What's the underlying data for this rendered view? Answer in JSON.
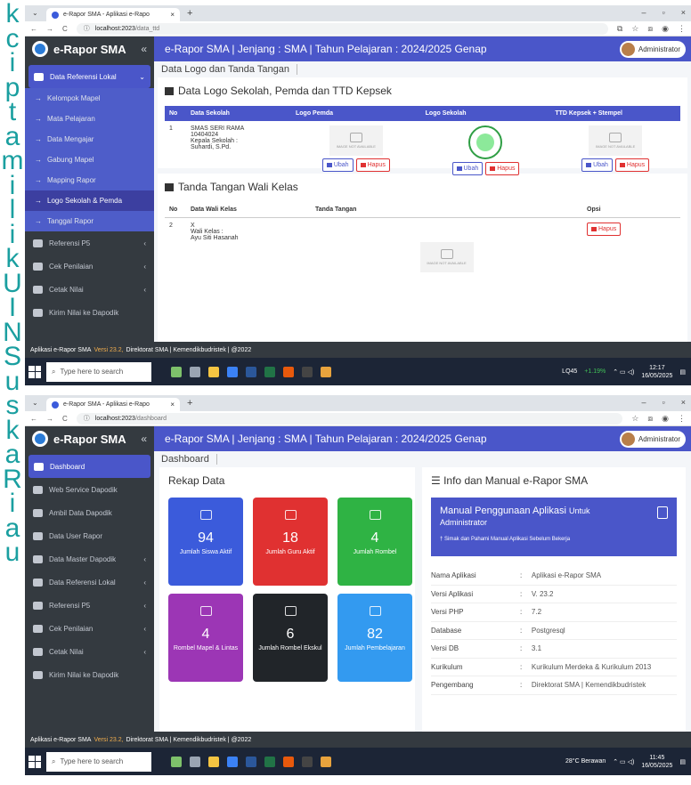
{
  "watermark": [
    "k",
    "c",
    "i",
    "p",
    "t",
    "a",
    "m",
    "i",
    "l",
    "i",
    "k",
    "U",
    "I",
    "N",
    "S",
    "u",
    "s",
    "k",
    "a",
    "R",
    "i",
    "a",
    "u"
  ],
  "app": {
    "brand": "e-Rapor SMA",
    "collapse": "«",
    "user": "Administrator",
    "footer_prefix": "Aplikasi e-Rapor SMA",
    "footer_version": "Versi 23.2,",
    "footer_suffix": "Direktorat SMA | Kemendikbudristek | @2022"
  },
  "taskbar": {
    "search": "Type here to search"
  },
  "panel1": {
    "tab": "e-Rapor SMA - Aplikasi e-Rapo",
    "url_host": "localhost:2023",
    "url_path": "/data_ttd",
    "title": "e-Rapor SMA | Jenjang : SMA | Tahun Pelajaran : 2024/2025 Genap",
    "breadcrumb": "Data Logo dan Tanda Tangan",
    "sidebar_group": "Data Referensi Lokal",
    "sidebar_sub": [
      "Kelompok Mapel",
      "Mata Pelajaran",
      "Data Mengajar",
      "Gabung Mapel",
      "Mapping Rapor",
      "Logo Sekolah & Pemda",
      "Tanggal Rapor"
    ],
    "sidebar_bottom": [
      "Referensi P5",
      "Cek Penilaian",
      "Cetak Nilai",
      "Kirim Nilai ke Dapodik"
    ],
    "card1_title": "Data Logo Sekolah, Pemda dan TTD Kepsek",
    "headers": [
      "No",
      "Data Sekolah",
      "Logo Pemda",
      "Logo Sekolah",
      "TTD Kepsek + Stempel"
    ],
    "row": {
      "no": "1",
      "school": "SMAS SERI RAMA",
      "npsn": "10404024",
      "kepsek_label": "Kepala Sekolah :",
      "kepsek": "Suhardi, S.Pd."
    },
    "img_placeholder": "IMAGE NOT AVAILABLE",
    "ubah": "Ubah",
    "hapus": "Hapus",
    "card2_title": "Tanda Tangan Wali Kelas",
    "wali_headers": [
      "No",
      "Data Wali Kelas",
      "Tanda Tangan",
      "Opsi"
    ],
    "wali_row": {
      "no": "2",
      "kelas": "X",
      "wali_label": "Wali Kelas :",
      "wali": "Ayu Siti Hasanah"
    },
    "tray": {
      "ticker": "LQ45",
      "change": "+1.19%",
      "time": "12:17",
      "date": "16/05/2025"
    }
  },
  "panel2": {
    "tab": "e-Rapor SMA - Aplikasi e-Rapo",
    "url_host": "localhost:2023",
    "url_path": "/dashboard",
    "title": "e-Rapor SMA | Jenjang : SMA | Tahun Pelajaran : 2024/2025 Genap",
    "breadcrumb": "Dashboard",
    "sidebar": [
      "Dashboard",
      "Web Service Dapodik",
      "Ambil Data Dapodik",
      "Data User Rapor",
      "Data Master Dapodik",
      "Data Referensi Lokal",
      "Referensi P5",
      "Cek Penilaian",
      "Cetak Nilai",
      "Kirim Nilai ke Dapodik"
    ],
    "rekap_title": "Rekap Data",
    "tiles": [
      {
        "num": "94",
        "label": "Jumlah Siswa Aktif",
        "color": "#3b5bdb"
      },
      {
        "num": "18",
        "label": "Jumlah Guru Aktif",
        "color": "#e03131"
      },
      {
        "num": "4",
        "label": "Jumlah Rombel",
        "color": "#2fb344"
      },
      {
        "num": "4",
        "label": "Rombel Mapel & Lintas",
        "color": "#9c36b5"
      },
      {
        "num": "6",
        "label": "Jumlah Rombel Ekskul",
        "color": "#212529"
      },
      {
        "num": "82",
        "label": "Jumlah Pembelajaran",
        "color": "#339af0"
      }
    ],
    "info_title": "Info dan Manual e-Rapor SMA",
    "manual_title": "Manual Penggunaan Aplikasi",
    "manual_for": "Untuk",
    "manual_role": "Administrator",
    "manual_note": "Simak dan Pahami Manual Aplikasi Sebelum Bekerja",
    "info": [
      {
        "k": "Nama Aplikasi",
        "v": "Aplikasi e-Rapor SMA"
      },
      {
        "k": "Versi Aplikasi",
        "v": "V. 23.2"
      },
      {
        "k": "Versi PHP",
        "v": "7.2"
      },
      {
        "k": "Database",
        "v": "Postgresql"
      },
      {
        "k": "Versi DB",
        "v": "3.1"
      },
      {
        "k": "Kurikulum",
        "v": "Kurikulum Merdeka & Kurikulum 2013"
      },
      {
        "k": "Pengembang",
        "v": "Direktorat SMA | Kemendikbudristek"
      }
    ],
    "tray": {
      "weather": "28°C Berawan",
      "time": "11:45",
      "date": "16/05/2025"
    }
  }
}
